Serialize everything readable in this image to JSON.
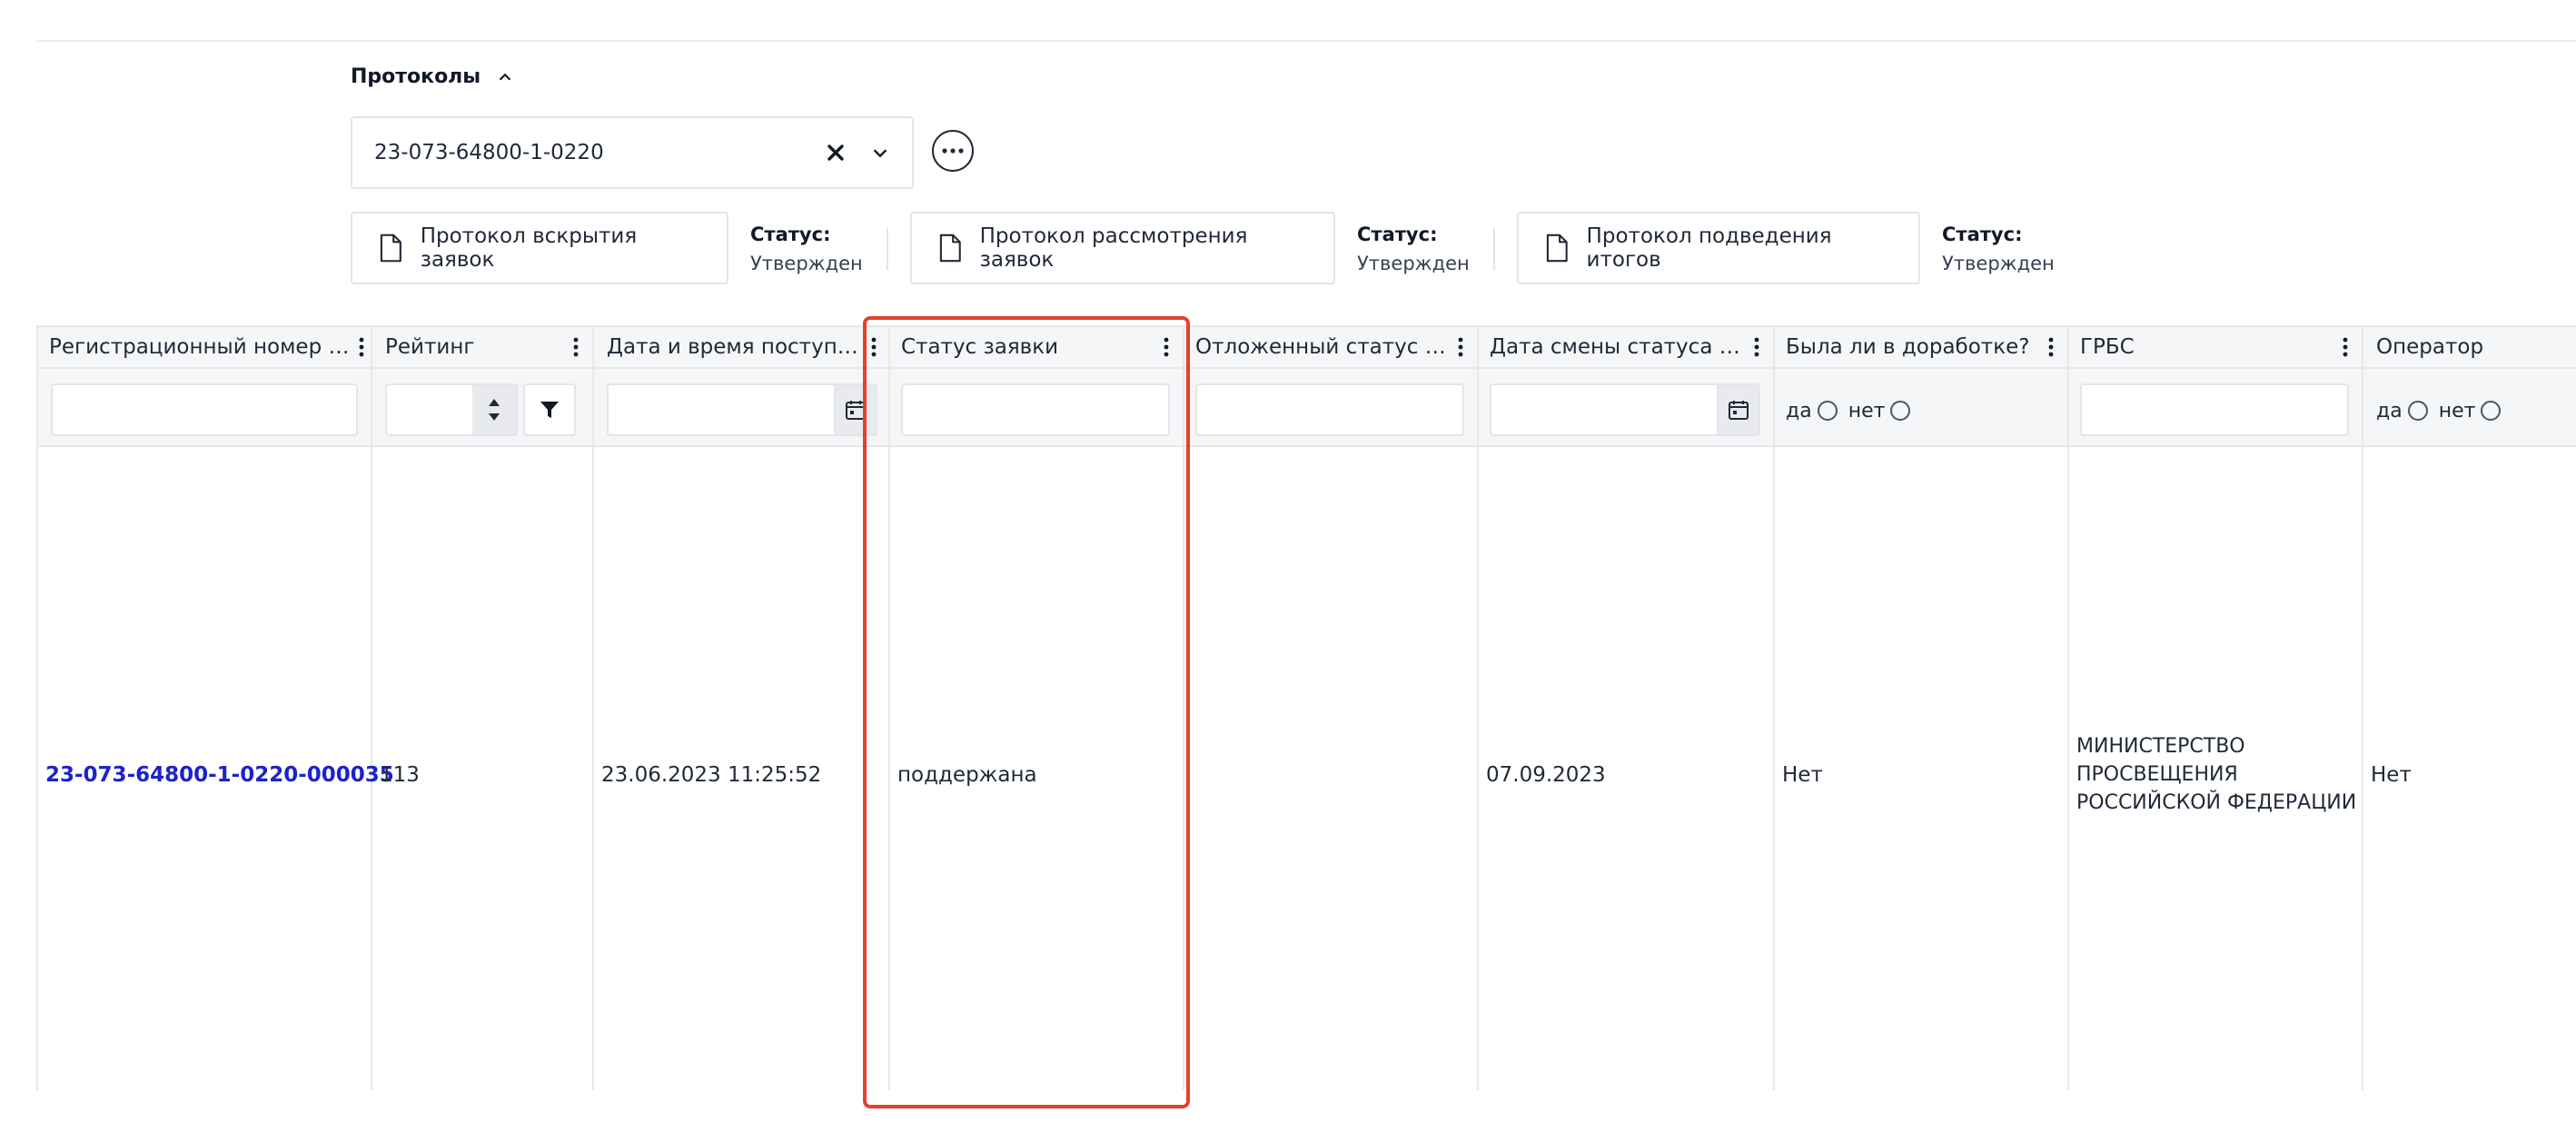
{
  "protocols": {
    "title": "Протоколы",
    "selected": "23-073-64800-1-0220",
    "buttons": [
      {
        "label": "Протокол вскрытия заявок",
        "status_label": "Статус:",
        "status": "Утвержден"
      },
      {
        "label": "Протокол рассмотрения заявок",
        "status_label": "Статус:",
        "status": "Утвержден"
      },
      {
        "label": "Протокол подведения итогов",
        "status_label": "Статус:",
        "status": "Утвержден"
      }
    ]
  },
  "table": {
    "columns": [
      {
        "label": "Регистрационный номер за..."
      },
      {
        "label": "Рейтинг"
      },
      {
        "label": "Дата и время поступлен..."
      },
      {
        "label": "Статус заявки"
      },
      {
        "label": "Отложенный статус зая..."
      },
      {
        "label": "Дата смены статуса зая..."
      },
      {
        "label": "Была ли в доработке?"
      },
      {
        "label": "ГРБС"
      },
      {
        "label": "Оператор"
      }
    ],
    "filters": {
      "yes": "да",
      "no": "нет"
    },
    "rows": [
      {
        "reg_number": "23-073-64800-1-0220-000035",
        "rating": "113",
        "received": "23.06.2023 11:25:52",
        "status": "поддержана",
        "deferred_status": "",
        "status_change_date": "07.09.2023",
        "was_revised": "Нет",
        "grbs_line1": "МИНИСТЕРСТВО",
        "grbs_line2": "ПРОСВЕЩЕНИЯ",
        "grbs_line3": "РОССИЙСКОЙ ФЕДЕРАЦИИ",
        "operator": "Нет"
      }
    ]
  },
  "colors": {
    "accent_link": "#1b24c8",
    "highlight": "#e5412d"
  },
  "icons": [
    "chevron-up-icon",
    "clear-icon",
    "chevron-down-icon",
    "more-icon",
    "document-icon",
    "kebab-icon",
    "calendar-icon",
    "filter-icon",
    "spinner-arrows-icon"
  ]
}
